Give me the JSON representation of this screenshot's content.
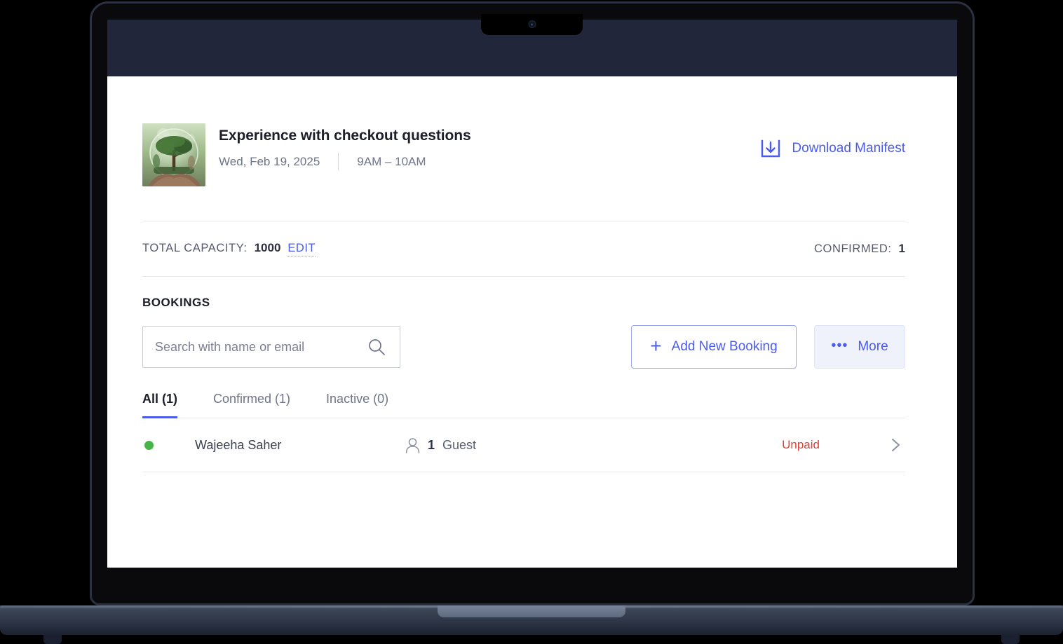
{
  "event": {
    "title": "Experience with checkout questions",
    "date": "Wed, Feb 19, 2025",
    "time": "9AM – 10AM",
    "thumbnail_alt": "tree-in-glass-globe-photo"
  },
  "header_actions": {
    "download_manifest_label": "Download Manifest",
    "download_icon": "download-tray-icon"
  },
  "capacity": {
    "label": "TOTAL CAPACITY:",
    "value": "1000",
    "edit_label": "EDIT",
    "confirmed_label": "CONFIRMED:",
    "confirmed_value": "1"
  },
  "bookings": {
    "section_title": "BOOKINGS",
    "search": {
      "placeholder": "Search with name or email",
      "value": "",
      "icon": "search-icon"
    },
    "buttons": {
      "add_label": "Add New Booking",
      "add_icon": "plus-icon",
      "more_label": "More",
      "more_icon": "ellipsis-icon"
    },
    "tabs": [
      {
        "label": "All (1)",
        "active": true
      },
      {
        "label": "Confirmed (1)",
        "active": false
      },
      {
        "label": "Inactive (0)",
        "active": false
      }
    ],
    "rows": [
      {
        "status_dot": "green",
        "name": "Wajeeha Saher",
        "guest_count": "1",
        "guest_word": "Guest",
        "guest_icon": "person-icon",
        "payment_status": "Unpaid",
        "chevron": "chevron-right-icon"
      }
    ]
  },
  "colors": {
    "accent_blue": "#4a5bee",
    "unpaid_red": "#dd4137",
    "active_green": "#45b546",
    "text_dark": "#1c1f2b",
    "text_muted": "#6e7489",
    "chrome_dark": "#22263a"
  }
}
